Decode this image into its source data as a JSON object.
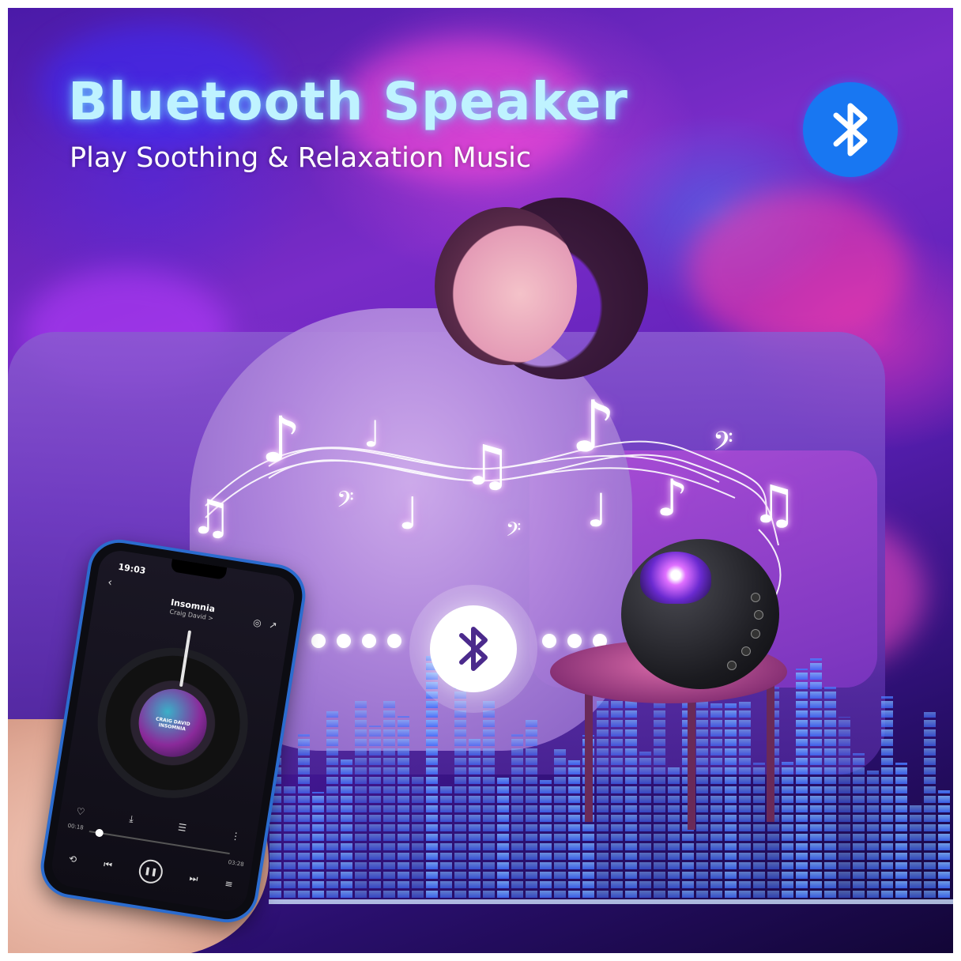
{
  "header": {
    "title": "Bluetooth Speaker",
    "subtitle": "Play Soothing & Relaxation Music"
  },
  "icons": {
    "top_badge": "bluetooth-icon",
    "center_badge": "bluetooth-icon",
    "notes": [
      "eighth-note",
      "beamed-notes",
      "bass-clef",
      "quarter-note"
    ]
  },
  "phone": {
    "status_time": "19:03",
    "song_title": "Insomnia",
    "artist": "Craig David",
    "artist_link": "Craig David >",
    "album_text_line1": "CRAIG DAVID",
    "album_text_line2": "INSOMNIA",
    "elapsed": "00:18",
    "duration": "03:28",
    "playback_progress": 0.09
  },
  "colors": {
    "title_glow": "#bff3ff",
    "badge_blue": "#1877f2",
    "phone_frame": "#2b6ccf",
    "background_purple": "#6a2ac0"
  }
}
